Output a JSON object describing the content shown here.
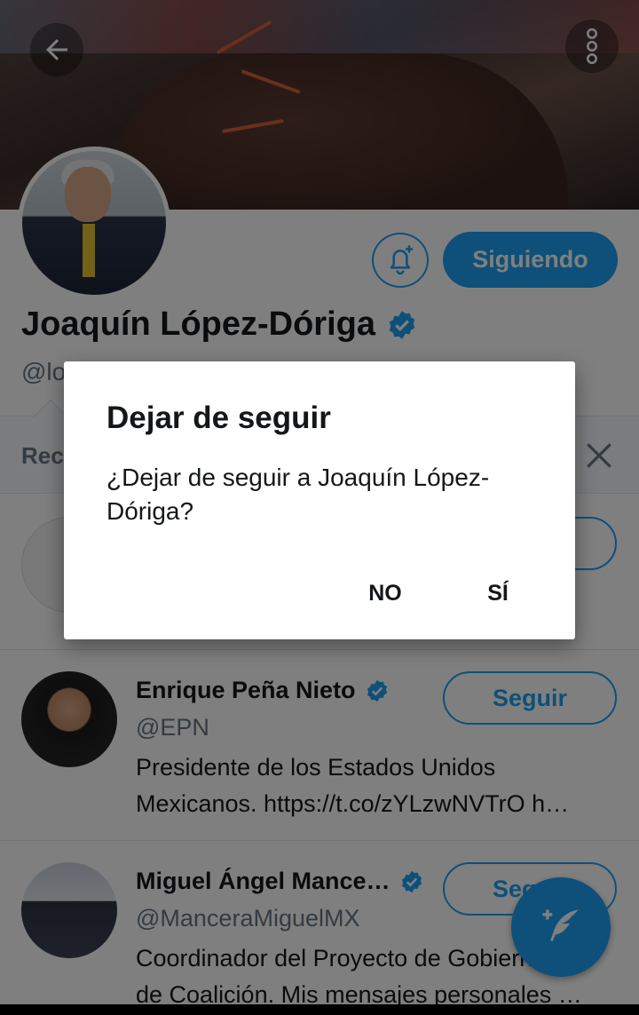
{
  "banner": {
    "alt": "shoe banner"
  },
  "nav": {
    "back_icon": "arrow-left-icon",
    "more_icon": "more-vertical-icon"
  },
  "profile": {
    "name": "Joaquín López-Dóriga",
    "handle": "@lopezdoriga",
    "verified": true,
    "bell_icon": "bell-plus-icon",
    "following_label": "Siguiendo"
  },
  "recommendations": {
    "title": "Recomendaciones",
    "items": [
      {
        "name": "Enrique Peña Nieto",
        "handle": "@EPN",
        "verified": true,
        "bio_line1": "Presidente de los Estados Unidos",
        "bio_line2": "Mexicanos. https://t.co/zYLzwNVTrO h…",
        "follow_label": "Seguir"
      },
      {
        "name": "Miguel Ángel Mance…",
        "handle": "@ManceraMiguelMX",
        "verified": true,
        "bio_line1": "Coordinador del Proyecto de Gobierno",
        "bio_line2": "de Coalición. Mis mensajes personales …",
        "follow_label": "Seguir"
      }
    ]
  },
  "fab": {
    "icon": "compose-tweet-icon"
  },
  "dialog": {
    "title": "Dejar de seguir",
    "message": "¿Dejar de seguir a Joaquín López-Dóriga?",
    "no_label": "NO",
    "yes_label": "SÍ"
  },
  "colors": {
    "accent": "#1da1f2",
    "scrim": "rgba(0,0,0,0.5)",
    "text": "#14171a",
    "muted": "#657786"
  }
}
